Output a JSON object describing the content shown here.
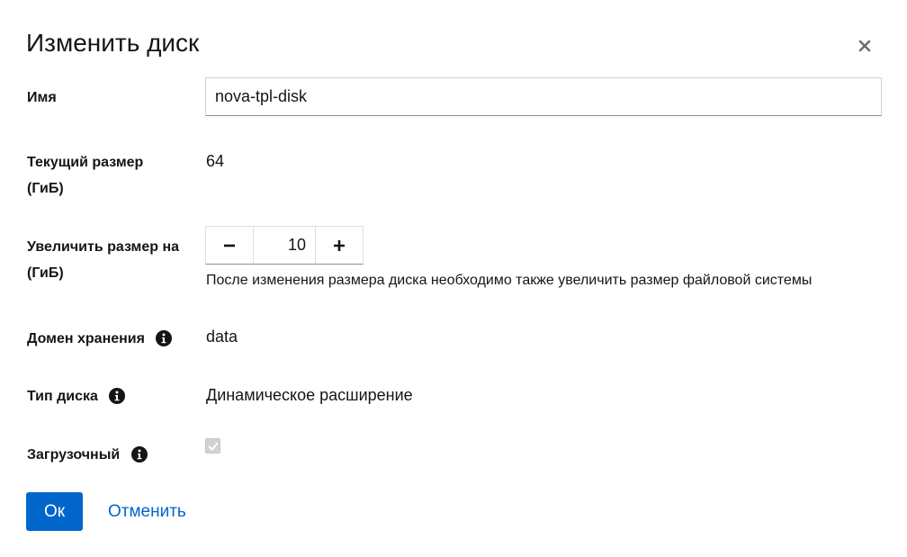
{
  "dialog": {
    "title": "Изменить диск",
    "close_icon": "close-icon"
  },
  "fields": {
    "name": {
      "label": "Имя",
      "value": "nova-tpl-disk"
    },
    "current_size": {
      "label_line1": "Текущий размер",
      "label_line2": "(ГиБ)",
      "value": "64"
    },
    "extend_size": {
      "label_line1": "Увеличить размер на",
      "label_line2": "(ГиБ)",
      "value": "10",
      "minus_icon": "minus-icon",
      "plus_icon": "plus-icon",
      "helper": "После изменения размера диска необходимо также увеличить размер файловой системы"
    },
    "storage_domain": {
      "label": "Домен хранения",
      "info_icon": "info-icon",
      "value": "data"
    },
    "disk_type": {
      "label": "Тип диска",
      "info_icon": "info-icon",
      "value": "Динамическое расширение"
    },
    "bootable": {
      "label": "Загрузочный",
      "info_icon": "info-icon",
      "checked": true,
      "disabled": true
    }
  },
  "actions": {
    "ok_label": "Ок",
    "cancel_label": "Отменить"
  },
  "colors": {
    "primary": "#0066cc",
    "text": "#151515"
  }
}
